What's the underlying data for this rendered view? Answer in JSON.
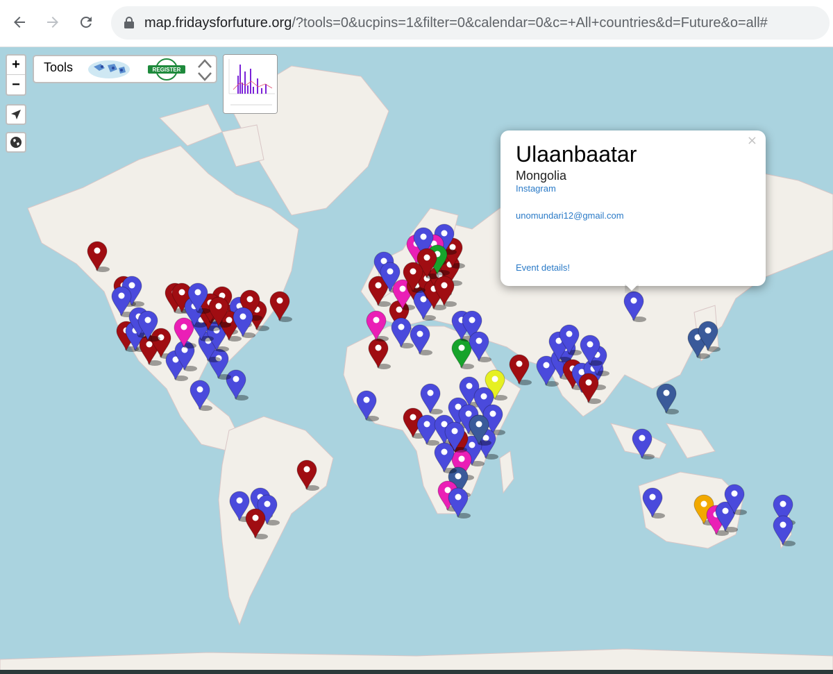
{
  "browser": {
    "url_host": "map.fridaysforfuture.org",
    "url_rest": "/?tools=0&ucpins=1&filter=0&calendar=0&c=+All+countries&d=Future&o=all#",
    "back_icon": "arrow-left-icon",
    "forward_icon": "arrow-right-icon",
    "reload_icon": "reload-icon",
    "lock_icon": "lock-icon"
  },
  "controls": {
    "zoom_in": "+",
    "zoom_out": "−",
    "locate_icon": "navigation-arrow-icon",
    "globe_icon": "globe-icon"
  },
  "tools": {
    "label": "Tools",
    "register_label": "REGISTER",
    "updown_icon": "chevron-up-down-icon"
  },
  "popup": {
    "city": "Ulaanbaatar",
    "country": "Mongolia",
    "instagram": "Instagram",
    "email": "unomundari12@gmail.com",
    "event_link": "Event details!",
    "close": "×"
  },
  "colors": {
    "water": "#aad3df",
    "land": "#f2efe9",
    "pin_blue": "#4a4adc",
    "pin_red": "#a00d12",
    "pin_magenta": "#ea1fb6",
    "pin_green": "#17a32b",
    "pin_yellow": "#e6f022",
    "pin_orange": "#f2a900",
    "pin_navy": "#3a5a9a"
  }
}
